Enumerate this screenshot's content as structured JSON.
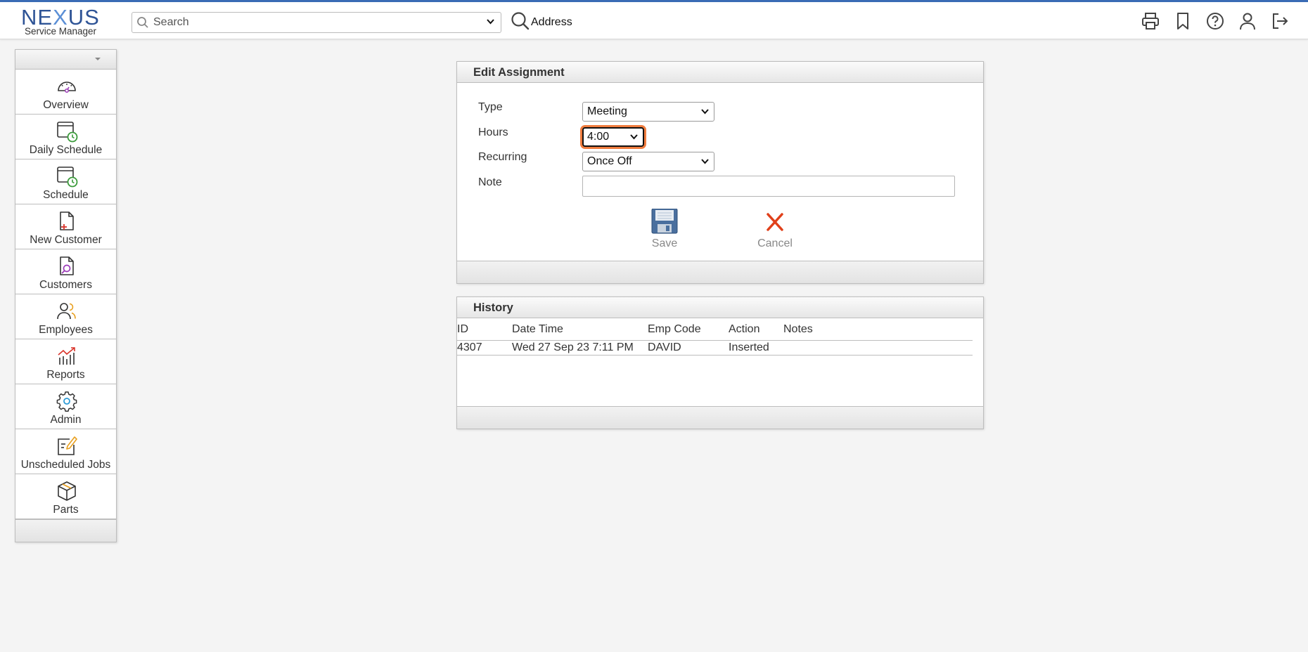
{
  "app": {
    "logo_main": "NEXUS",
    "logo_sub": "Service Manager"
  },
  "search": {
    "placeholder": "Search",
    "scope_value": "Address"
  },
  "top_icons": [
    "printer-icon",
    "bookmark-icon",
    "help-icon",
    "user-icon",
    "logout-icon"
  ],
  "sidebar": {
    "items": [
      {
        "label": "Overview",
        "icon": "gauge-icon"
      },
      {
        "label": "Daily Schedule",
        "icon": "calendar-clock-icon"
      },
      {
        "label": "Schedule",
        "icon": "calendar-clock-icon"
      },
      {
        "label": "New Customer",
        "icon": "new-document-icon"
      },
      {
        "label": "Customers",
        "icon": "document-search-icon"
      },
      {
        "label": "Employees",
        "icon": "people-icon"
      },
      {
        "label": "Reports",
        "icon": "chart-icon"
      },
      {
        "label": "Admin",
        "icon": "gear-icon"
      },
      {
        "label": "Unscheduled Jobs",
        "icon": "edit-note-icon"
      },
      {
        "label": "Parts",
        "icon": "box-icon"
      }
    ]
  },
  "edit_assignment": {
    "title": "Edit Assignment",
    "type_label": "Type",
    "type_value": "Meeting",
    "hours_label": "Hours",
    "hours_value": "4:00",
    "recurring_label": "Recurring",
    "recurring_value": "Once Off",
    "note_label": "Note",
    "note_value": "",
    "save_label": "Save",
    "cancel_label": "Cancel"
  },
  "history": {
    "title": "History",
    "columns": [
      "ID",
      "Date Time",
      "Emp Code",
      "Action",
      "Notes"
    ],
    "rows": [
      [
        "4307",
        "Wed 27 Sep 23 7:11 PM",
        "DAVID",
        "Inserted",
        ""
      ]
    ]
  },
  "colors": {
    "brand": "#2f5496",
    "accent_bar": "#3a6bb5",
    "focus_ring": "#f07c3e",
    "cancel_red": "#e0401a"
  }
}
